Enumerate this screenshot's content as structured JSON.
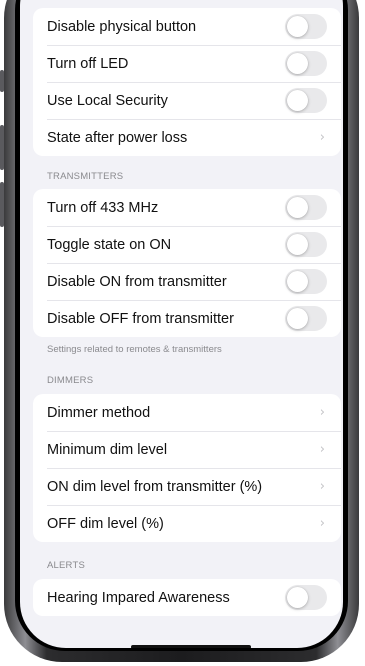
{
  "groups": [
    {
      "header": "",
      "footer": "",
      "rows": [
        {
          "label": "Disable physical button",
          "control": "toggle",
          "on": false
        },
        {
          "label": "Turn off LED",
          "control": "toggle",
          "on": false
        },
        {
          "label": "Use Local Security",
          "control": "toggle",
          "on": false
        },
        {
          "label": "State after power loss",
          "control": "chevron"
        }
      ]
    },
    {
      "header": "TRANSMITTERS",
      "footer": "Settings related to remotes & transmitters",
      "rows": [
        {
          "label": "Turn off 433 MHz",
          "control": "toggle",
          "on": false
        },
        {
          "label": "Toggle state on ON",
          "control": "toggle",
          "on": false
        },
        {
          "label": "Disable ON from transmitter",
          "control": "toggle",
          "on": false
        },
        {
          "label": "Disable OFF from transmitter",
          "control": "toggle",
          "on": false
        }
      ]
    },
    {
      "header": "DIMMERS",
      "footer": "",
      "rows": [
        {
          "label": "Dimmer method",
          "control": "chevron"
        },
        {
          "label": "Minimum dim level",
          "control": "chevron"
        },
        {
          "label": "ON dim level from transmitter (%)",
          "control": "chevron"
        },
        {
          "label": "OFF dim level (%)",
          "control": "chevron"
        }
      ]
    },
    {
      "header": "ALERTS",
      "footer": "",
      "rows": [
        {
          "label": "Hearing Impared Awareness",
          "control": "toggle",
          "on": false
        }
      ]
    }
  ],
  "chevron_glyph": "›",
  "colors": {
    "background": "#f2f2f7",
    "toggle_off": "#e9e9eb",
    "secondary_text": "#8a8a8e"
  }
}
